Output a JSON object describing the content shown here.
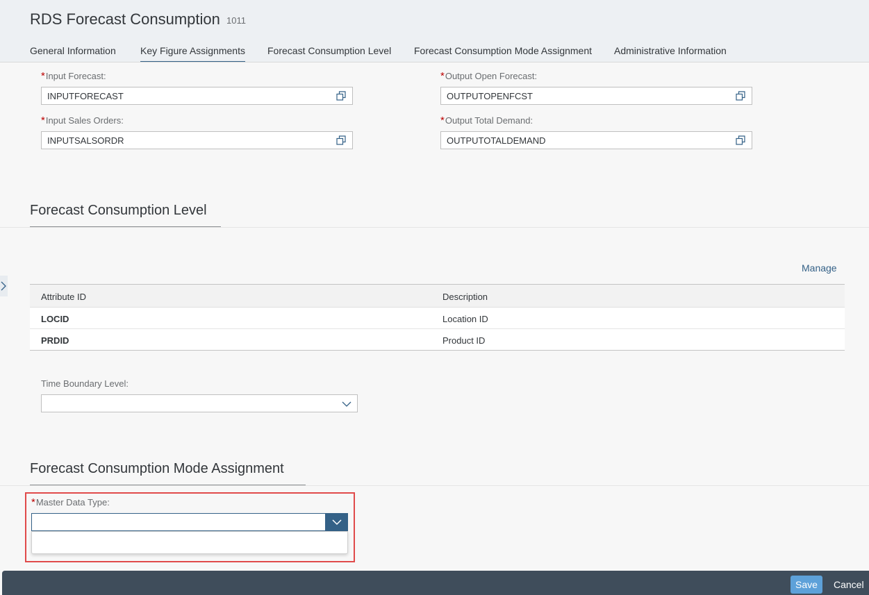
{
  "header": {
    "title": "RDS Forecast Consumption",
    "subtitle": "1011",
    "tabs": [
      {
        "label": "General Information"
      },
      {
        "label": "Key Figure Assignments"
      },
      {
        "label": "Forecast Consumption Level"
      },
      {
        "label": "Forecast Consumption Mode Assignment"
      },
      {
        "label": "Administrative Information"
      }
    ],
    "active_tab": "Key Figure Assignments"
  },
  "key_figures": {
    "input_forecast": {
      "label": "Input Forecast:",
      "value": "INPUTFORECAST",
      "required": "*"
    },
    "input_sales_orders": {
      "label": "Input Sales Orders:",
      "value": "INPUTSALSORDR",
      "required": "*"
    },
    "output_open_forecast": {
      "label": "Output Open Forecast:",
      "value": "OUTPUTOPENFCST",
      "required": "*"
    },
    "output_total_demand": {
      "label": "Output Total Demand:",
      "value": "OUTPUTOTALDEMAND",
      "required": "*"
    }
  },
  "level_section": {
    "title": "Forecast Consumption Level",
    "manage_label": "Manage",
    "columns": [
      "Attribute ID",
      "Description"
    ],
    "rows": [
      {
        "attribute_id": "LOCID",
        "description": "Location ID"
      },
      {
        "attribute_id": "PRDID",
        "description": "Product ID"
      }
    ],
    "time_boundary_label": "Time Boundary Level:",
    "time_boundary_value": ""
  },
  "mode_section": {
    "title": "Forecast Consumption Mode Assignment",
    "master_data_label": "Master Data Type:",
    "required": "*",
    "master_data_value": ""
  },
  "footer": {
    "save_label": "Save",
    "cancel_label": "Cancel"
  },
  "colors": {
    "accent": "#346187",
    "required": "#bb0000",
    "highlight": "#e04a4a",
    "footer_bg": "#3f4d5b",
    "save_bg": "#5da1d9"
  }
}
